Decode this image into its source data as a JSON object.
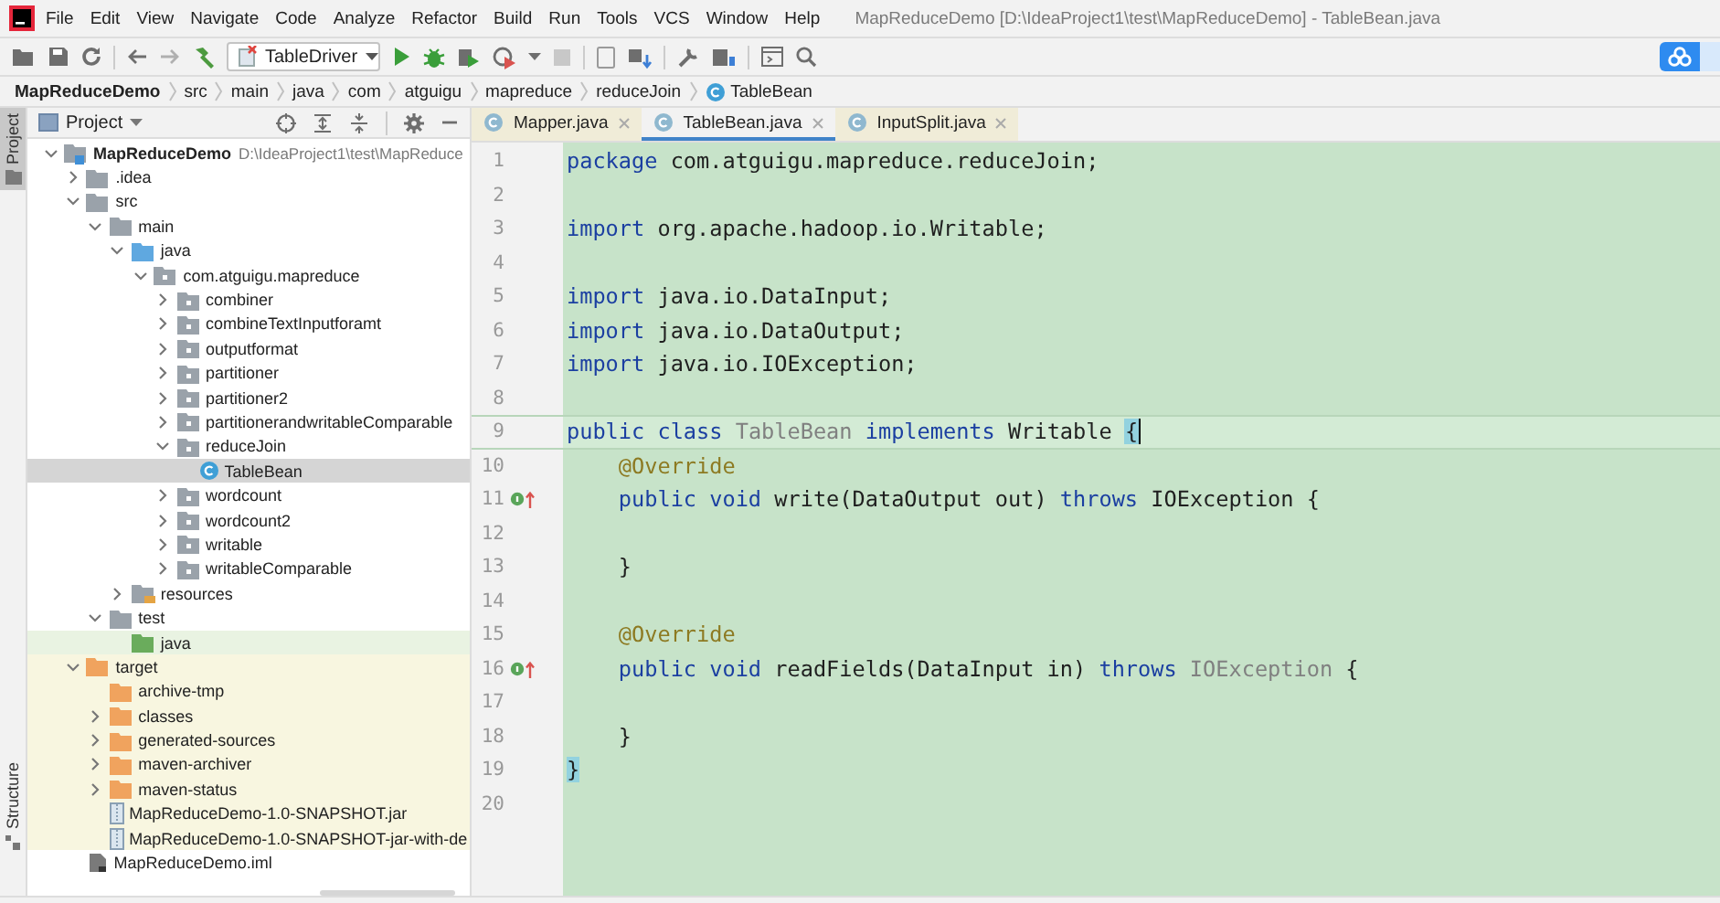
{
  "menu": [
    "File",
    "Edit",
    "View",
    "Navigate",
    "Code",
    "Analyze",
    "Refactor",
    "Build",
    "Run",
    "Tools",
    "VCS",
    "Window",
    "Help"
  ],
  "window": {
    "title": "MapReduceDemo [D:\\IdeaProject1\\test\\MapReduceDemo] - TableBean.java"
  },
  "run_config": {
    "label": "TableDriver"
  },
  "breadcrumbs": [
    {
      "label": "MapReduceDemo",
      "kind": "project"
    },
    {
      "label": "src",
      "kind": "dir"
    },
    {
      "label": "main",
      "kind": "dir"
    },
    {
      "label": "java",
      "kind": "dir"
    },
    {
      "label": "com",
      "kind": "dir"
    },
    {
      "label": "atguigu",
      "kind": "dir"
    },
    {
      "label": "mapreduce",
      "kind": "dir"
    },
    {
      "label": "reduceJoin",
      "kind": "dir"
    },
    {
      "label": "TableBean",
      "kind": "class"
    }
  ],
  "side_tabs": [
    {
      "label": "Project",
      "selected": true,
      "kind": "project"
    },
    {
      "label": "Structure",
      "selected": false,
      "kind": "structure"
    }
  ],
  "project_panel": {
    "title": "Project",
    "tree": [
      {
        "label": "MapReduceDemo",
        "kind": "module",
        "hint": "D:\\IdeaProject1\\test\\MapReduce",
        "expanded": true,
        "selected": false,
        "children": [
          {
            "label": ".idea",
            "kind": "folder",
            "expanded": false,
            "selected": false
          },
          {
            "label": "src",
            "kind": "folder",
            "expanded": true,
            "selected": false,
            "children": [
              {
                "label": "main",
                "kind": "folder",
                "expanded": true,
                "selected": false,
                "children": [
                  {
                    "label": "java",
                    "kind": "source",
                    "expanded": true,
                    "selected": false,
                    "children": [
                      {
                        "label": "com.atguigu.mapreduce",
                        "kind": "package",
                        "expanded": true,
                        "selected": false,
                        "children": [
                          {
                            "label": "combiner",
                            "kind": "package",
                            "expanded": false,
                            "selected": false
                          },
                          {
                            "label": "combineTextInputforamt",
                            "kind": "package",
                            "expanded": false,
                            "selected": false
                          },
                          {
                            "label": "outputformat",
                            "kind": "package",
                            "expanded": false,
                            "selected": false
                          },
                          {
                            "label": "partitioner",
                            "kind": "package",
                            "expanded": false,
                            "selected": false
                          },
                          {
                            "label": "partitioner2",
                            "kind": "package",
                            "expanded": false,
                            "selected": false
                          },
                          {
                            "label": "partitionerandwritableComparable",
                            "kind": "package",
                            "expanded": false,
                            "selected": false
                          },
                          {
                            "label": "reduceJoin",
                            "kind": "package",
                            "expanded": true,
                            "selected": false,
                            "children": [
                              {
                                "label": "TableBean",
                                "kind": "class",
                                "selected": true
                              }
                            ]
                          },
                          {
                            "label": "wordcount",
                            "kind": "package",
                            "expanded": false,
                            "selected": false
                          },
                          {
                            "label": "wordcount2",
                            "kind": "package",
                            "expanded": false,
                            "selected": false
                          },
                          {
                            "label": "writable",
                            "kind": "package",
                            "expanded": false,
                            "selected": false
                          },
                          {
                            "label": "writableComparable",
                            "kind": "package",
                            "expanded": false,
                            "selected": false
                          }
                        ]
                      }
                    ]
                  },
                  {
                    "label": "resources",
                    "kind": "resources",
                    "expanded": false,
                    "selected": false
                  }
                ]
              },
              {
                "label": "test",
                "kind": "folder",
                "expanded": true,
                "selected": false,
                "children": [
                  {
                    "label": "java",
                    "kind": "test-source",
                    "selected": false
                  }
                ]
              }
            ]
          },
          {
            "label": "target",
            "kind": "excluded",
            "expanded": true,
            "selected": false,
            "children": [
              {
                "label": "archive-tmp",
                "kind": "excluded",
                "selected": false
              },
              {
                "label": "classes",
                "kind": "excluded",
                "expanded": false,
                "selected": false
              },
              {
                "label": "generated-sources",
                "kind": "excluded",
                "expanded": false,
                "selected": false
              },
              {
                "label": "maven-archiver",
                "kind": "excluded",
                "expanded": false,
                "selected": false
              },
              {
                "label": "maven-status",
                "kind": "excluded",
                "expanded": false,
                "selected": false
              },
              {
                "label": "MapReduceDemo-1.0-SNAPSHOT.jar",
                "kind": "jar",
                "selected": false
              },
              {
                "label": "MapReduceDemo-1.0-SNAPSHOT-jar-with-de",
                "kind": "jar",
                "selected": false
              }
            ]
          },
          {
            "label": "MapReduceDemo.iml",
            "kind": "iml",
            "selected": false
          }
        ]
      }
    ]
  },
  "editor_tabs": [
    {
      "label": "Mapper.java",
      "selected": false
    },
    {
      "label": "TableBean.java",
      "selected": true
    },
    {
      "label": "InputSplit.java",
      "selected": false
    }
  ],
  "code": [
    {
      "number": "1",
      "current": false,
      "overrides": false,
      "tokens": [
        {
          "kind": "keyword",
          "text": "package"
        },
        {
          "kind": "plain",
          "text": " com.atguigu.mapreduce.reduceJoin;"
        }
      ]
    },
    {
      "number": "2",
      "current": false,
      "overrides": false
    },
    {
      "number": "3",
      "current": false,
      "overrides": false,
      "tokens": [
        {
          "kind": "keyword",
          "text": "import"
        },
        {
          "kind": "plain",
          "text": " org.apache.hadoop.io.Writable;"
        }
      ]
    },
    {
      "number": "4",
      "current": false,
      "overrides": false
    },
    {
      "number": "5",
      "current": false,
      "overrides": false,
      "tokens": [
        {
          "kind": "keyword",
          "text": "import"
        },
        {
          "kind": "plain",
          "text": " java.io.DataInput;"
        }
      ]
    },
    {
      "number": "6",
      "current": false,
      "overrides": false,
      "tokens": [
        {
          "kind": "keyword",
          "text": "import"
        },
        {
          "kind": "plain",
          "text": " java.io.DataOutput;"
        }
      ]
    },
    {
      "number": "7",
      "current": false,
      "overrides": false,
      "tokens": [
        {
          "kind": "keyword",
          "text": "import"
        },
        {
          "kind": "plain",
          "text": " java.io.IOException;"
        }
      ]
    },
    {
      "number": "8",
      "current": false,
      "overrides": false
    },
    {
      "number": "9",
      "current": true,
      "overrides": false,
      "tokens": [
        {
          "kind": "keyword",
          "text": "public class"
        },
        {
          "kind": "unused",
          "text": " TableBean"
        },
        {
          "kind": "keyword",
          "text": " implements"
        },
        {
          "kind": "plain",
          "text": " Writable "
        },
        {
          "kind": "brace-match",
          "text": "{"
        }
      ]
    },
    {
      "number": "10",
      "current": false,
      "overrides": false,
      "tokens": [
        {
          "kind": "annotation",
          "text": "    @Override"
        }
      ]
    },
    {
      "number": "11",
      "current": false,
      "overrides": true,
      "tokens": [
        {
          "kind": "keyword",
          "text": "    public void"
        },
        {
          "kind": "plain",
          "text": " write(DataOutput out)"
        },
        {
          "kind": "keyword",
          "text": " throws"
        },
        {
          "kind": "plain",
          "text": " IOException {"
        }
      ]
    },
    {
      "number": "12",
      "current": false,
      "overrides": false
    },
    {
      "number": "13",
      "current": false,
      "overrides": false,
      "tokens": [
        {
          "kind": "plain",
          "text": "    }"
        }
      ]
    },
    {
      "number": "14",
      "current": false,
      "overrides": false
    },
    {
      "number": "15",
      "current": false,
      "overrides": false,
      "tokens": [
        {
          "kind": "annotation",
          "text": "    @Override"
        }
      ]
    },
    {
      "number": "16",
      "current": false,
      "overrides": true,
      "tokens": [
        {
          "kind": "keyword",
          "text": "    public void"
        },
        {
          "kind": "plain",
          "text": " readFields(DataInput in)"
        },
        {
          "kind": "keyword",
          "text": " throws"
        },
        {
          "kind": "unused",
          "text": " IOException"
        },
        {
          "kind": "plain",
          "text": " {"
        }
      ]
    },
    {
      "number": "17",
      "current": false,
      "overrides": false
    },
    {
      "number": "18",
      "current": false,
      "overrides": false,
      "tokens": [
        {
          "kind": "plain",
          "text": "    }"
        }
      ]
    },
    {
      "number": "19",
      "current": false,
      "overrides": false,
      "tokens": [
        {
          "kind": "brace-match",
          "text": "}"
        }
      ]
    },
    {
      "number": "20",
      "current": false,
      "overrides": false
    }
  ]
}
